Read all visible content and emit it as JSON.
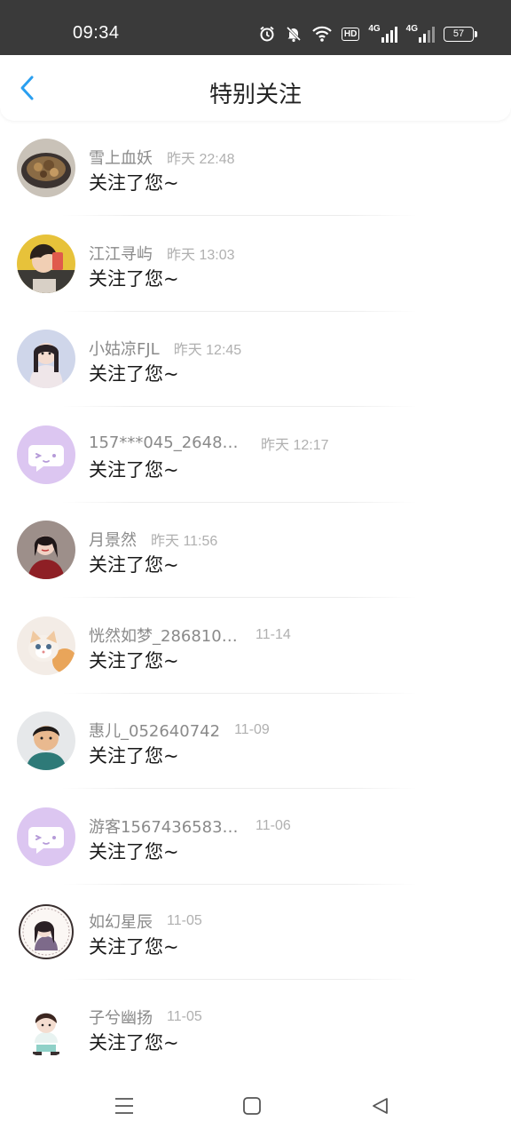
{
  "status_bar": {
    "time": "09:34",
    "hd_label": "HD",
    "net1_label": "4G",
    "net2_label": "4G",
    "battery_level": "57",
    "icons": [
      "alarm-icon",
      "mute-icon",
      "wifi-icon",
      "hd-icon",
      "signal-4g-icon",
      "signal-4g-icon",
      "battery-icon"
    ]
  },
  "header": {
    "title": "特别关注",
    "back_icon": "chevron-left-icon",
    "accent": "#2a9ff0"
  },
  "notifications": [
    {
      "name": "雪上血妖",
      "time": "昨天 22:48",
      "message": "关注了您~",
      "avatar": "food-photo"
    },
    {
      "name": "江江寻屿",
      "time": "昨天 13:03",
      "message": "关注了您~",
      "avatar": "girl-photo-yellow"
    },
    {
      "name": "小姑凉FJL",
      "time": "昨天 12:45",
      "message": "关注了您~",
      "avatar": "girl-photo-braids"
    },
    {
      "name": "157***045_26480...",
      "time": "昨天 12:17",
      "message": "关注了您~",
      "avatar": "default-chat-avatar"
    },
    {
      "name": "月景然",
      "time": "昨天 11:56",
      "message": "关注了您~",
      "avatar": "girl-photo-red"
    },
    {
      "name": "恍然如梦_2868100...",
      "time": "11-14",
      "message": "关注了您~",
      "avatar": "kitten-photo"
    },
    {
      "name": "惠儿_052640742",
      "time": "11-09",
      "message": "关注了您~",
      "avatar": "woman-photo"
    },
    {
      "name": "游客15674365830...",
      "time": "11-06",
      "message": "关注了您~",
      "avatar": "default-chat-avatar"
    },
    {
      "name": "如幻星辰",
      "time": "11-05",
      "message": "关注了您~",
      "avatar": "cartoon-girl-badge"
    },
    {
      "name": "子兮幽扬",
      "time": "11-05",
      "message": "关注了您~",
      "avatar": "cartoon-boy"
    }
  ],
  "nav_bar": {
    "icons": [
      "menu-icon",
      "home-square-icon",
      "back-triangle-icon"
    ]
  }
}
